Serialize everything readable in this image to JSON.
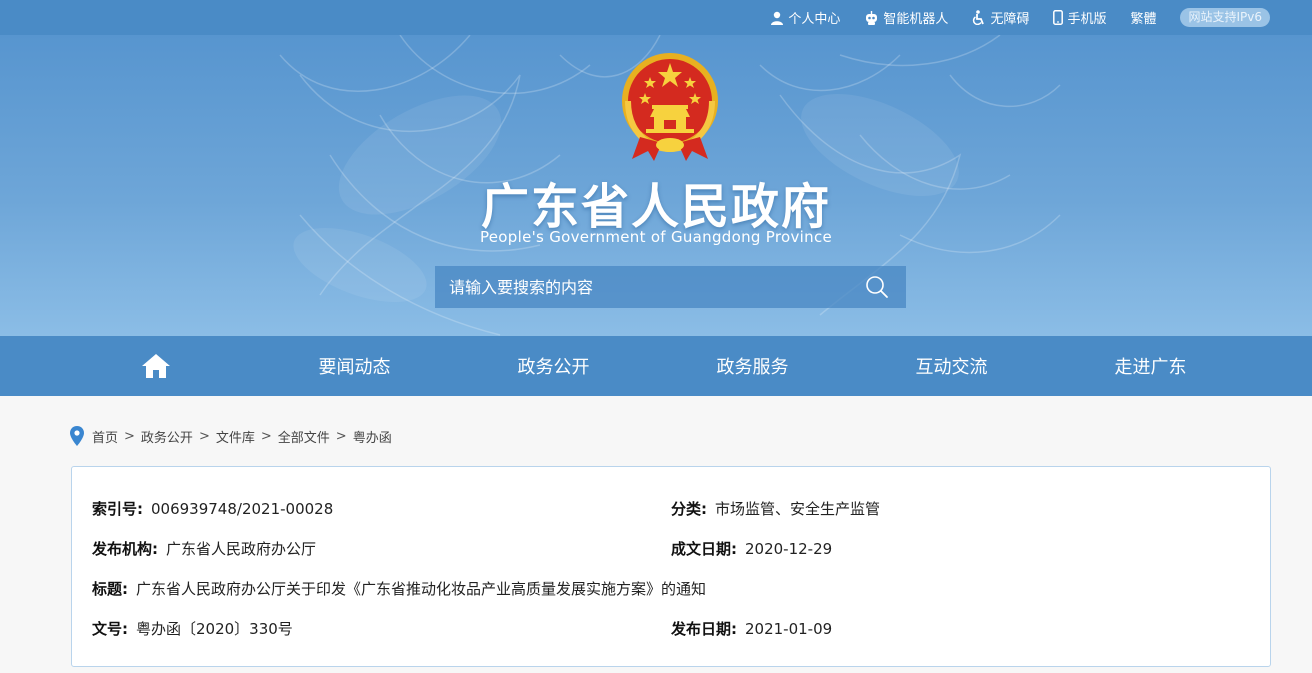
{
  "topbar": {
    "links": [
      {
        "label": "个人中心",
        "icon": "user-icon"
      },
      {
        "label": "智能机器人",
        "icon": "robot-icon"
      },
      {
        "label": "无障碍",
        "icon": "accessibility-icon"
      },
      {
        "label": "手机版",
        "icon": "mobile-icon"
      },
      {
        "label": "繁體",
        "icon": ""
      }
    ],
    "ipv6_badge": "网站支持IPv6"
  },
  "banner": {
    "emblem": "national-emblem",
    "title": "广东省人民政府",
    "subtitle": "People's Government of Guangdong Province"
  },
  "search": {
    "placeholder": "请输入要搜索的内容"
  },
  "nav": {
    "home_icon": "home-icon",
    "items": [
      "要闻动态",
      "政务公开",
      "政务服务",
      "互动交流",
      "走进广东"
    ]
  },
  "breadcrumb": [
    "首页",
    "政务公开",
    "文件库",
    "全部文件",
    "粤办函"
  ],
  "info": {
    "index_no": {
      "label": "索引号:",
      "value": "006939748/2021-00028"
    },
    "category": {
      "label": "分类:",
      "value": "市场监管、安全生产监管"
    },
    "publisher": {
      "label": "发布机构:",
      "value": "广东省人民政府办公厅"
    },
    "written_date": {
      "label": "成文日期:",
      "value": "2020-12-29"
    },
    "title": {
      "label": "标题:",
      "value": "广东省人民政府办公厅关于印发《广东省推动化妆品产业高质量发展实施方案》的通知"
    },
    "doc_no": {
      "label": "文号:",
      "value": "粤办函〔2020〕330号"
    },
    "publish_date": {
      "label": "发布日期:",
      "value": "2021-01-09"
    }
  },
  "colors": {
    "primary": "#4a8bc6",
    "banner_top": "#5795cf",
    "banner_bottom": "#8bbde6",
    "box_border": "#b9d4ec"
  }
}
